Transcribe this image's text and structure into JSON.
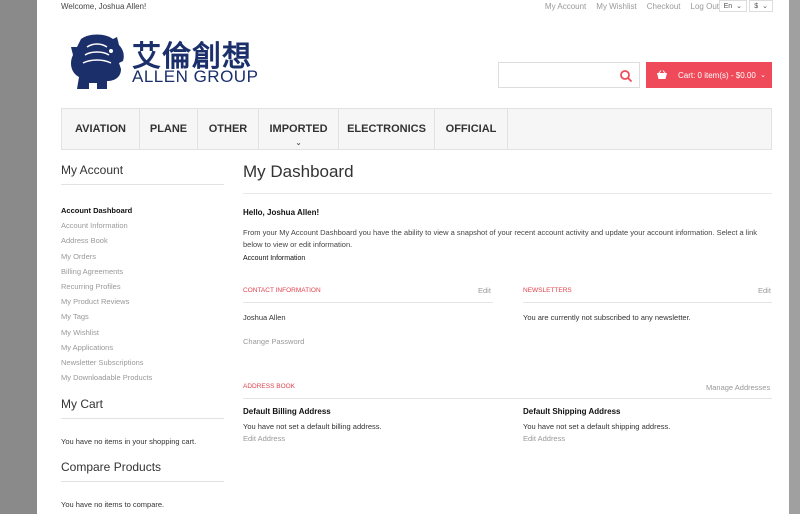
{
  "topbar": {
    "welcome": "Welcome, Joshua Allen!",
    "links": [
      "My Account",
      "My Wishlist",
      "Checkout",
      "Log Out"
    ],
    "language": "En",
    "currency": "$"
  },
  "logo": {
    "chinese": "艾倫創想",
    "english": "ALLEN GROUP"
  },
  "search": {
    "placeholder": ""
  },
  "cart": {
    "label": "Cart: 0 item(s) - $0.00"
  },
  "nav": [
    "AVIATION",
    "PLANE",
    "OTHER",
    "IMPORTED",
    "ELECTRONICS",
    "OFFICIAL"
  ],
  "sidebar": {
    "account_title": "My Account",
    "items": [
      "Account Dashboard",
      "Account Information",
      "Address Book",
      "My Orders",
      "Billing Agreements",
      "Recurring Profiles",
      "My Product Reviews",
      "My Tags",
      "My Wishlist",
      "My Applications",
      "Newsletter Subscriptions",
      "My Downloadable Products"
    ],
    "cart_title": "My Cart",
    "cart_text": "You have no items in your shopping cart.",
    "compare_title": "Compare Products",
    "compare_text": "You have no items to compare."
  },
  "main": {
    "title": "My Dashboard",
    "hello": "Hello, Joshua Allen!",
    "intro": "From your My Account Dashboard you have the ability to view a snapshot of your recent account activity and update your account information. Select a link below to view or edit information.",
    "account_info": "Account Information",
    "contact": {
      "title": "CONTACT INFORMATION",
      "edit": "Edit",
      "name": "Joshua Allen",
      "change_password": "Change Password"
    },
    "newsletters": {
      "title": "NEWSLETTERS",
      "edit": "Edit",
      "text": "You are currently not subscribed to any newsletter."
    },
    "address_book": {
      "title": "ADDRESS BOOK",
      "manage": "Manage Addresses"
    },
    "billing": {
      "title": "Default Billing Address",
      "text": "You have not set a default billing address.",
      "edit": "Edit Address"
    },
    "shipping": {
      "title": "Default Shipping Address",
      "text": "You have not set a default shipping address.",
      "edit": "Edit Address"
    }
  },
  "colors": {
    "accent": "#ee4a59",
    "brand": "#1b2f6b"
  }
}
